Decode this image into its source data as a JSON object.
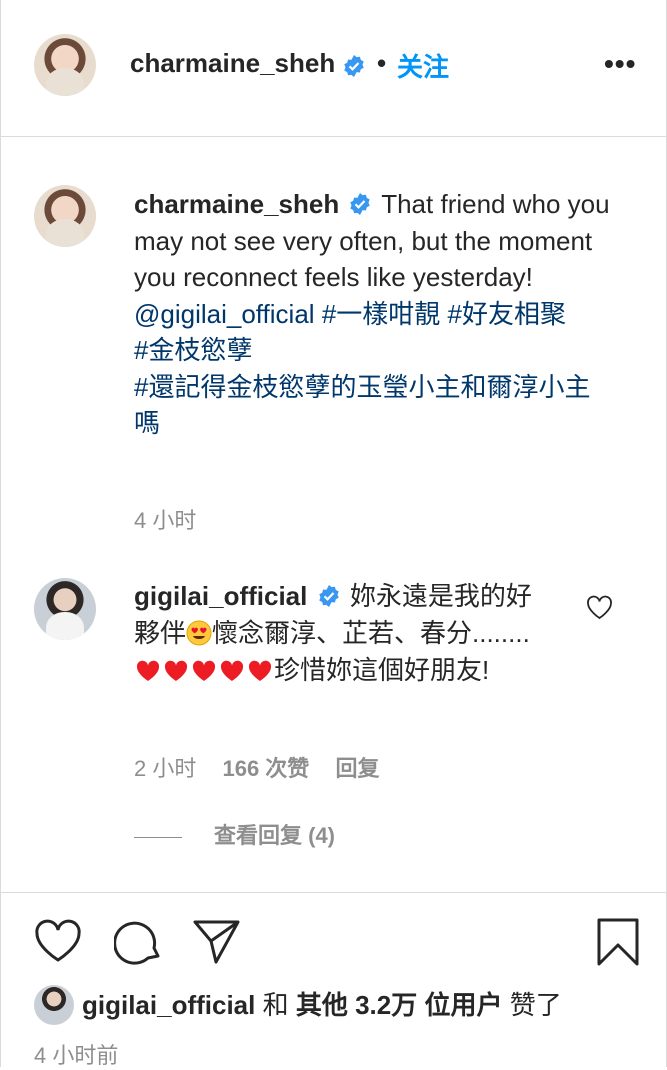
{
  "header": {
    "username": "charmaine_sheh",
    "separator": "•",
    "follow_label": "关注",
    "more_label": "•••"
  },
  "caption": {
    "username": "charmaine_sheh",
    "text": "That friend who you may not see very often, but the moment you reconnect feels like yesterday!",
    "mention": "@gigilai_official",
    "hashtags": [
      "#一樣咁靚",
      "#好友相聚",
      "#金枝慾孽",
      "#還記得金枝慾孽的玉瑩小主和爾淳小主嗎"
    ],
    "time": "4 小时"
  },
  "comment": {
    "username": "gigilai_official",
    "text_part1": "妳永遠是我的好夥伴",
    "text_part2": "懷念爾淳、芷若、春分........",
    "text_part3": "珍惜妳這個好朋友!",
    "time": "2 小时",
    "likes": "166 次赞",
    "reply": "回复",
    "view_replies": "查看回复 (4)"
  },
  "likes_line": {
    "user": "gigilai_official",
    "and": "和",
    "others": "其他 3.2万 位用户",
    "liked": "赞了"
  },
  "post_time": "4 小时前",
  "colors": {
    "accent": "#0095f6",
    "hashtag": "#00376b",
    "muted": "#8e8e8e",
    "heart_red": "#ed1c24",
    "verified": "#3897f0"
  }
}
